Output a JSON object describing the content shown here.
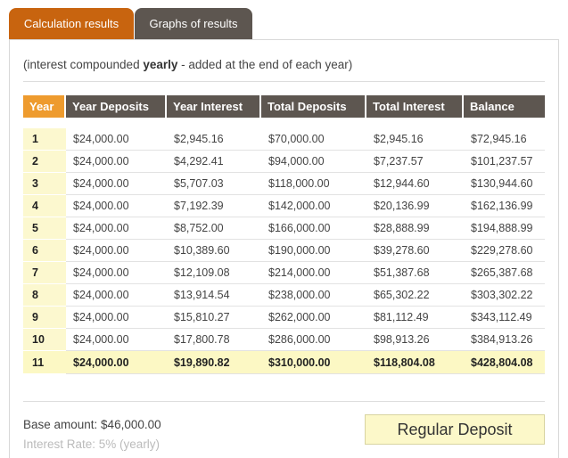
{
  "tabs": {
    "calculation": "Calculation results",
    "graphs": "Graphs of results"
  },
  "note": {
    "prefix": "(interest compounded ",
    "emphasis": "yearly",
    "suffix": " - added at the end of each year)"
  },
  "table": {
    "headers": [
      "Year",
      "Year Deposits",
      "Year Interest",
      "Total Deposits",
      "Total Interest",
      "Balance"
    ],
    "rows": [
      [
        "1",
        "$24,000.00",
        "$2,945.16",
        "$70,000.00",
        "$2,945.16",
        "$72,945.16"
      ],
      [
        "2",
        "$24,000.00",
        "$4,292.41",
        "$94,000.00",
        "$7,237.57",
        "$101,237.57"
      ],
      [
        "3",
        "$24,000.00",
        "$5,707.03",
        "$118,000.00",
        "$12,944.60",
        "$130,944.60"
      ],
      [
        "4",
        "$24,000.00",
        "$7,192.39",
        "$142,000.00",
        "$20,136.99",
        "$162,136.99"
      ],
      [
        "5",
        "$24,000.00",
        "$8,752.00",
        "$166,000.00",
        "$28,888.99",
        "$194,888.99"
      ],
      [
        "6",
        "$24,000.00",
        "$10,389.60",
        "$190,000.00",
        "$39,278.60",
        "$229,278.60"
      ],
      [
        "7",
        "$24,000.00",
        "$12,109.08",
        "$214,000.00",
        "$51,387.68",
        "$265,387.68"
      ],
      [
        "8",
        "$24,000.00",
        "$13,914.54",
        "$238,000.00",
        "$65,302.22",
        "$303,302.22"
      ],
      [
        "9",
        "$24,000.00",
        "$15,810.27",
        "$262,000.00",
        "$81,112.49",
        "$343,112.49"
      ],
      [
        "10",
        "$24,000.00",
        "$17,800.78",
        "$286,000.00",
        "$98,913.26",
        "$384,913.26"
      ],
      [
        "11",
        "$24,000.00",
        "$19,890.82",
        "$310,000.00",
        "$118,804.08",
        "$428,804.08"
      ]
    ]
  },
  "summary": {
    "base_amount": "Base amount: $46,000.00",
    "interest_rate": "Interest Rate: 5% (yearly)"
  },
  "regular_deposit_label": "Regular Deposit",
  "colors": {
    "active_tab": "#c8640f",
    "header_dark": "#5d5650",
    "year_header": "#ee9b2e",
    "highlight": "#fcf8c4"
  }
}
